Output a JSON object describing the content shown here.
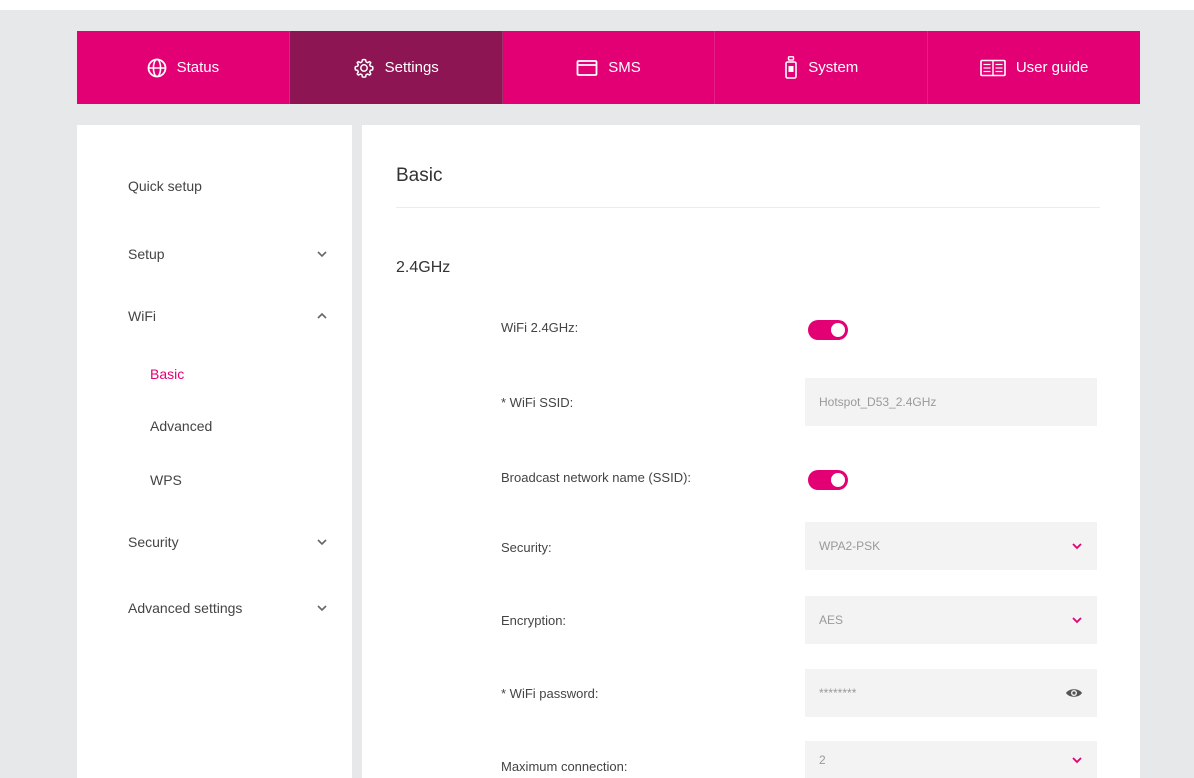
{
  "nav": {
    "items": [
      {
        "label": "Status",
        "icon": "globe-icon"
      },
      {
        "label": "Settings",
        "icon": "gear-icon",
        "active": true
      },
      {
        "label": "SMS",
        "icon": "envelope-icon"
      },
      {
        "label": "System",
        "icon": "hotspot-device-icon"
      },
      {
        "label": "User guide",
        "icon": "guide-icon"
      }
    ]
  },
  "sidebar": {
    "quick_setup": "Quick setup",
    "setup": "Setup",
    "wifi": "WiFi",
    "wifi_basic": "Basic",
    "wifi_advanced": "Advanced",
    "wifi_wps": "WPS",
    "security": "Security",
    "advanced_settings": "Advanced settings"
  },
  "main": {
    "title": "Basic",
    "section": "2.4GHz",
    "fields": {
      "wifi_24_label": "WiFi 2.4GHz:",
      "ssid_label": "* WiFi SSID:",
      "ssid_value": "Hotspot_D53_2.4GHz",
      "broadcast_label": "Broadcast network name (SSID):",
      "security_label": "Security:",
      "security_value": "WPA2-PSK",
      "encryption_label": "Encryption:",
      "encryption_value": "AES",
      "password_label": "* WiFi password:",
      "password_value": "********",
      "maxconn_label": "Maximum connection:",
      "maxconn_value": "2"
    }
  },
  "colors": {
    "brand": "#e20074",
    "brand_active": "#8e1553",
    "page_bg": "#e6e8ea",
    "input_bg": "#f3f3f3"
  }
}
